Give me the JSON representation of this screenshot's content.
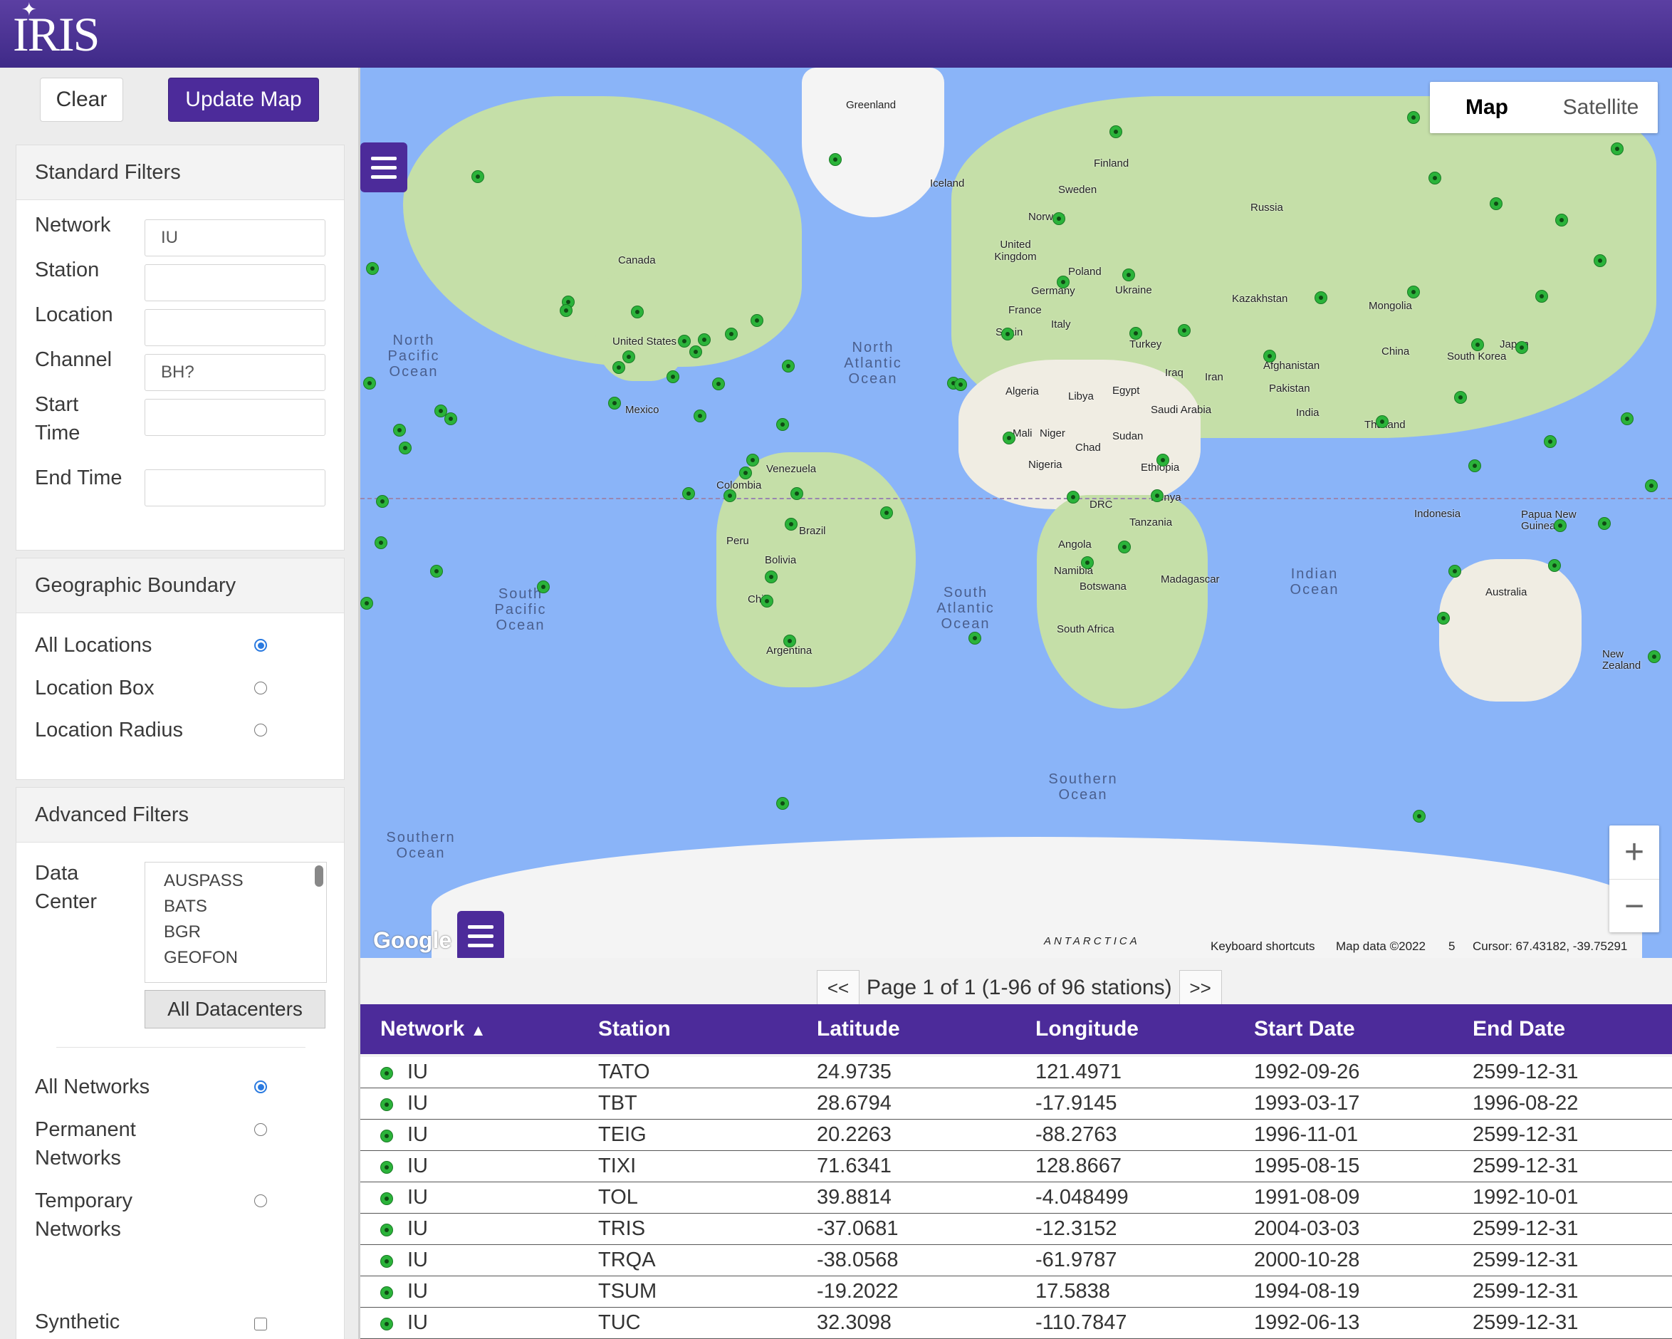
{
  "app": {
    "logo_text": "IRIS"
  },
  "toolbar": {
    "clear_label": "Clear",
    "update_label": "Update Map"
  },
  "standard_filters": {
    "title": "Standard Filters",
    "network_label": "Network",
    "network_value": "IU",
    "station_label": "Station",
    "station_value": "",
    "location_label": "Location",
    "location_value": "",
    "channel_label": "Channel",
    "channel_value": "BH?",
    "start_label_1": "Start",
    "start_label_2": "Time",
    "start_value": "",
    "end_label": "End Time",
    "end_value": ""
  },
  "geo": {
    "title": "Geographic Boundary",
    "options": [
      "All Locations",
      "Location Box",
      "Location Radius"
    ],
    "selected": "All Locations"
  },
  "advanced": {
    "title": "Advanced Filters",
    "datacenter_label_1": "Data",
    "datacenter_label_2": "Center",
    "datacenters": [
      "AUSPASS",
      "BATS",
      "BGR",
      "GEOFON"
    ],
    "all_datacenters_label": "All Datacenters",
    "network_options": [
      "All Networks",
      "Permanent",
      "Networks",
      "Temporary",
      "Networks"
    ],
    "selected_network": "All Networks",
    "synthetic_label": "Synthetic"
  },
  "map": {
    "type_map": "Map",
    "type_satellite": "Satellite",
    "active_type": "Map",
    "labels": [
      "Greenland",
      "Iceland",
      "Finland",
      "Sweden",
      "Norway",
      "Russia",
      "Canada",
      "United Kingdom",
      "Poland",
      "Germany",
      "Ukraine",
      "France",
      "Italy",
      "Spain",
      "Kazakhstan",
      "Mongolia",
      "Turkey",
      "China",
      "South Korea",
      "Japan",
      "United States",
      "Mexico",
      "Algeria",
      "Libya",
      "Egypt",
      "Iraq",
      "Iran",
      "Afghanistan",
      "Pakistan",
      "Saudi Arabia",
      "India",
      "Mali",
      "Niger",
      "Chad",
      "Sudan",
      "Thailand",
      "Nigeria",
      "Ethiopia",
      "Venezuela",
      "Colombia",
      "Kenya",
      "DRC",
      "Tanzania",
      "Indonesia",
      "Papua New Guinea",
      "Brazil",
      "Peru",
      "Bolivia",
      "Angola",
      "Namibia",
      "Botswana",
      "Madagascar",
      "Australia",
      "Chile",
      "South Africa",
      "Argentina",
      "New Zealand",
      "ANTARCTICA"
    ],
    "oceans": [
      "North Pacific Ocean",
      "North Atlantic Ocean",
      "South Pacific Ocean",
      "South Atlantic Ocean",
      "Indian Ocean",
      "Southern Ocean",
      "Southern Ocean"
    ],
    "google_logo": "Google",
    "attribution": {
      "shortcuts": "Keyboard shortcuts",
      "data": "Map data ©2022",
      "scale": "5",
      "cursor": "Cursor: 67.43182, -39.75291"
    },
    "zoom_in": "+",
    "zoom_out": "−"
  },
  "pager": {
    "prev": "<<",
    "text": "Page 1 of 1 (1-96 of 96 stations)",
    "next": ">>"
  },
  "table": {
    "headers": [
      "Network",
      "Station",
      "Latitude",
      "Longitude",
      "Start Date",
      "End Date"
    ],
    "sort_icon": "▲",
    "rows": [
      [
        "IU",
        "TATO",
        "24.9735",
        "121.4971",
        "1992-09-26",
        "2599-12-31"
      ],
      [
        "IU",
        "TBT",
        "28.6794",
        "-17.9145",
        "1993-03-17",
        "1996-08-22"
      ],
      [
        "IU",
        "TEIG",
        "20.2263",
        "-88.2763",
        "1996-11-01",
        "2599-12-31"
      ],
      [
        "IU",
        "TIXI",
        "71.6341",
        "128.8667",
        "1995-08-15",
        "2599-12-31"
      ],
      [
        "IU",
        "TOL",
        "39.8814",
        "-4.048499",
        "1991-08-09",
        "1992-10-01"
      ],
      [
        "IU",
        "TRIS",
        "-37.0681",
        "-12.3152",
        "2004-03-03",
        "2599-12-31"
      ],
      [
        "IU",
        "TRQA",
        "-38.0568",
        "-61.9787",
        "2000-10-28",
        "2599-12-31"
      ],
      [
        "IU",
        "TSUM",
        "-19.2022",
        "17.5838",
        "1994-08-19",
        "2599-12-31"
      ],
      [
        "IU",
        "TUC",
        "32.3098",
        "-110.7847",
        "1992-06-13",
        "2599-12-31"
      ]
    ]
  }
}
